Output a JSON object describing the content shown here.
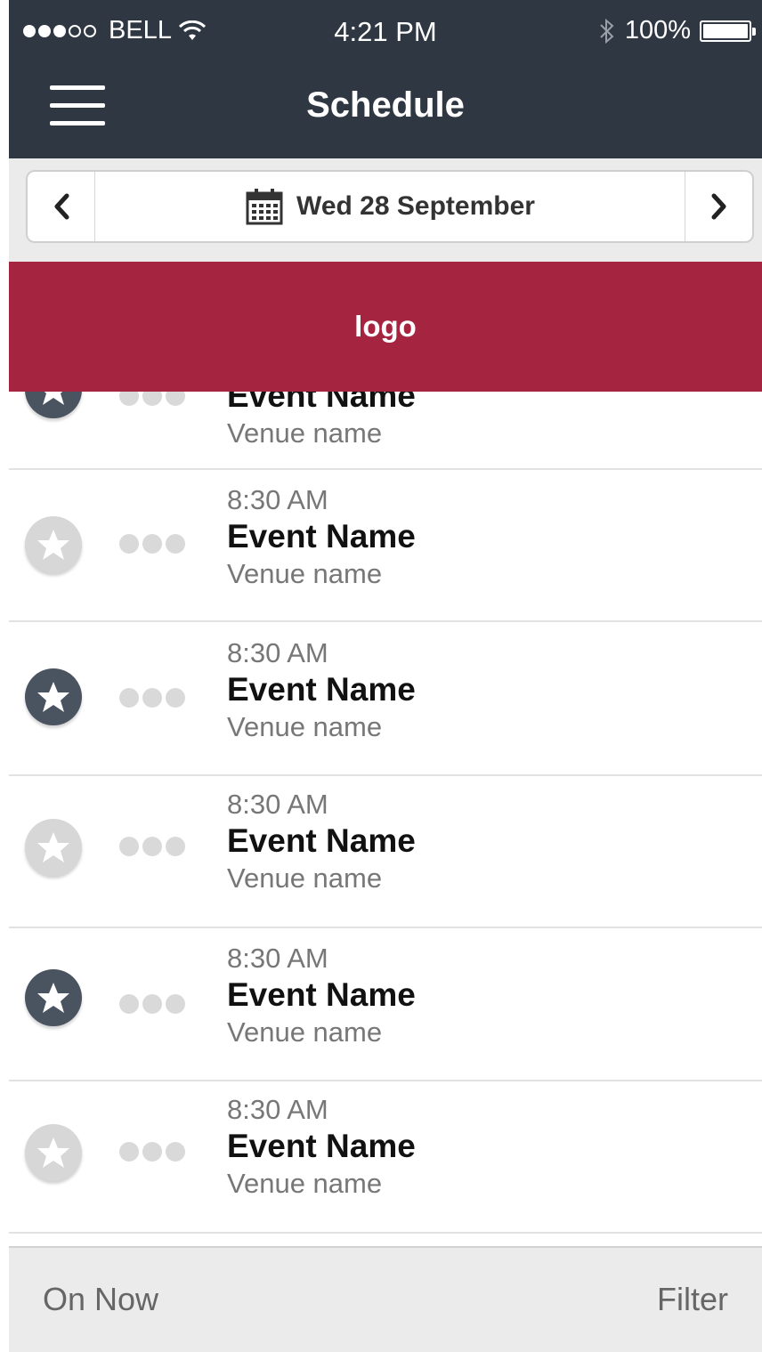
{
  "status_bar": {
    "carrier": "BELL",
    "time": "4:21 PM",
    "battery": "100%"
  },
  "nav": {
    "title": "Schedule"
  },
  "date_picker": {
    "date": "Wed 28 September"
  },
  "banner": {
    "text": "logo"
  },
  "events": [
    {
      "time": "",
      "name": "Event Name",
      "venue": "Venue name",
      "favorite": true
    },
    {
      "time": "8:30 AM",
      "name": "Event Name",
      "venue": "Venue name",
      "favorite": false
    },
    {
      "time": "8:30 AM",
      "name": "Event Name",
      "venue": "Venue name",
      "favorite": true
    },
    {
      "time": "8:30 AM",
      "name": "Event Name",
      "venue": "Venue name",
      "favorite": false
    },
    {
      "time": "8:30 AM",
      "name": "Event Name",
      "venue": "Venue name",
      "favorite": true
    },
    {
      "time": "8:30 AM",
      "name": "Event Name",
      "venue": "Venue name",
      "favorite": false
    }
  ],
  "toolbar": {
    "left_label": "On Now",
    "right_label": "Filter"
  },
  "colors": {
    "header": "#2f3742",
    "banner": "#a52541",
    "star_on": "#4a5360",
    "star_off": "#d7d7d7"
  }
}
